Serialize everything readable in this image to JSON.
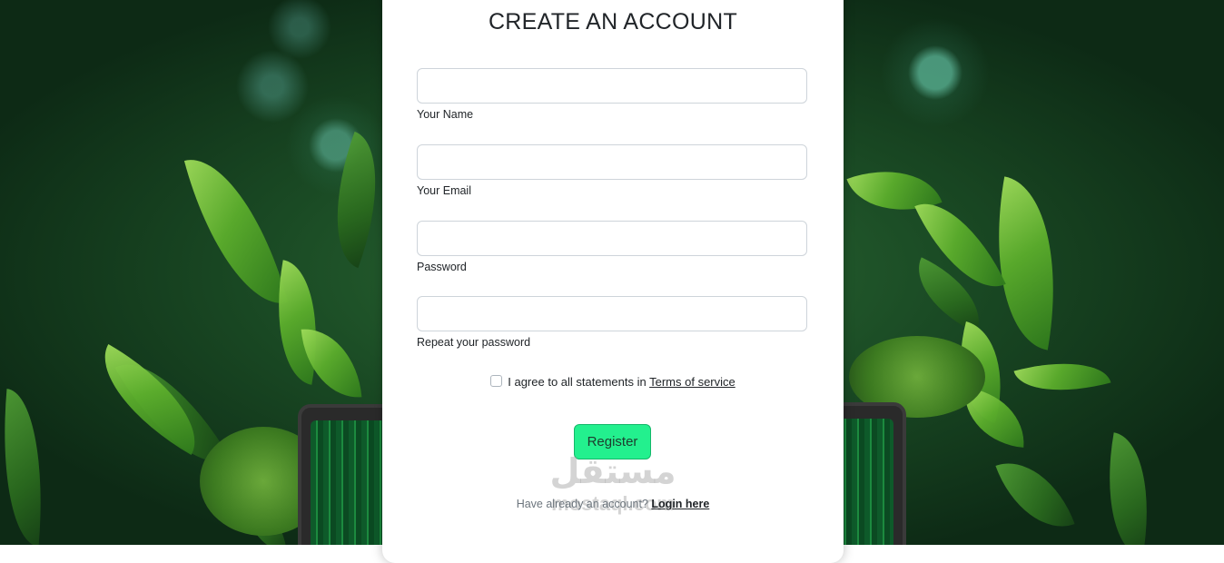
{
  "form": {
    "title": "CREATE AN ACCOUNT",
    "fields": [
      {
        "label": "Your Name",
        "value": ""
      },
      {
        "label": "Your Email",
        "value": ""
      },
      {
        "label": "Password",
        "value": ""
      },
      {
        "label": "Repeat your password",
        "value": ""
      }
    ],
    "agree_text": "I agree to all statements in ",
    "terms_link": "Terms of service",
    "agree_checked": false,
    "register_label": "Register",
    "login_prompt": "Have already an account? ",
    "login_link": "Login here"
  },
  "watermark": {
    "arabic": "مستقل",
    "latin": "mostaql.com"
  },
  "colors": {
    "register_button": "#23f08e",
    "background": "#0c2613"
  }
}
